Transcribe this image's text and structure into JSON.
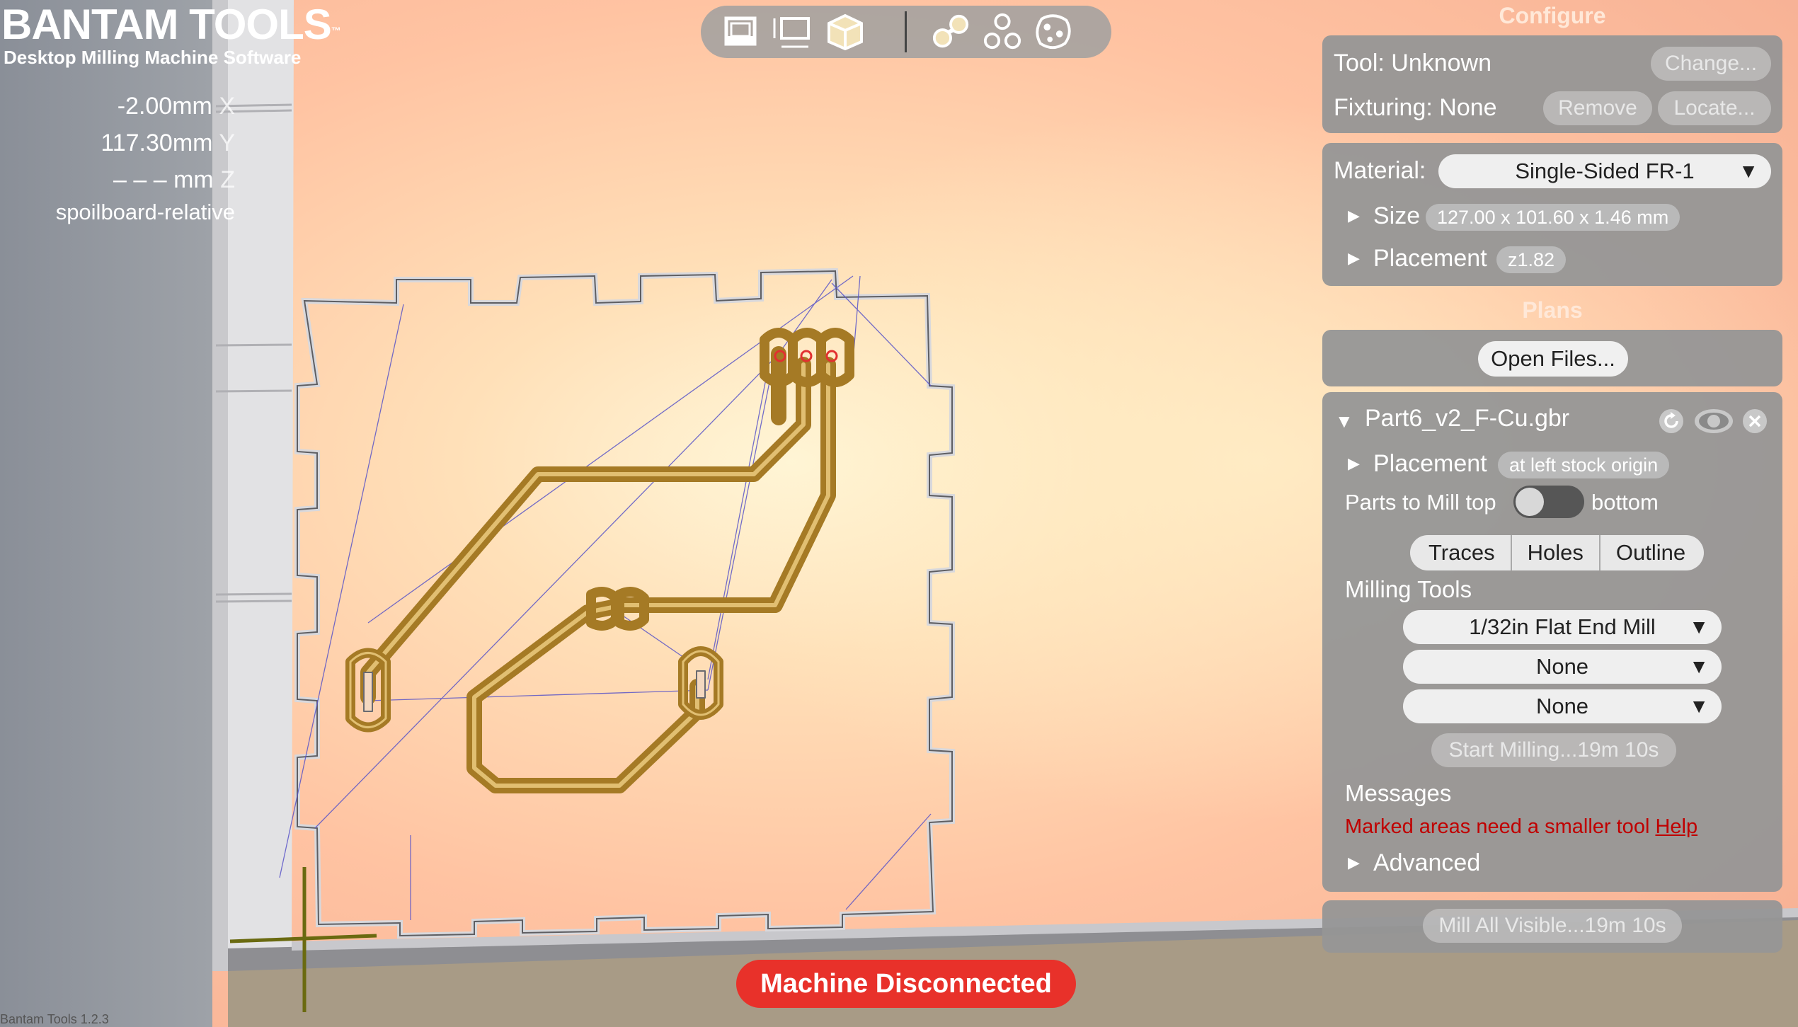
{
  "brand": {
    "logo": "BANTAM TOOLS",
    "tm": "™",
    "subtitle": "Desktop Milling Machine Software"
  },
  "readout": {
    "x_value": "-2.00mm",
    "x_axis": "X",
    "y_value": "117.30mm",
    "y_axis": "Y",
    "z_value": "– – – mm",
    "z_axis": "Z",
    "mode": "spoilboard-relative"
  },
  "view_toolbar": {
    "buttons": [
      "front-view",
      "top-view",
      "3d-view",
      "show-traces",
      "show-holes",
      "show-outline"
    ]
  },
  "configure": {
    "title": "Configure",
    "tool_label": "Tool: Unknown",
    "change_button": "Change...",
    "fixturing_label": "Fixturing: None",
    "remove_button": "Remove",
    "locate_button": "Locate...",
    "material_label": "Material:",
    "material_value": "Single-Sided FR-1",
    "size_label": "Size",
    "size_value": "127.00 x 101.60 x 1.46 mm",
    "placement_label": "Placement",
    "placement_value": "z1.82"
  },
  "plans": {
    "title": "Plans",
    "open_files_button": "Open Files...",
    "file_name": "Part6_v2_F-Cu.gbr",
    "placement_label": "Placement",
    "placement_value": "at left stock origin",
    "parts_label": "Parts to Mill",
    "parts_top": "top",
    "parts_bottom": "bottom",
    "tabs": [
      "Traces",
      "Holes",
      "Outline"
    ],
    "milling_tools_label": "Milling Tools",
    "tool_1": "1/32in Flat End Mill",
    "tool_2": "None",
    "tool_3": "None",
    "start_milling_button": "Start Milling...19m 10s",
    "messages_label": "Messages",
    "message_text": "Marked areas need a smaller tool",
    "message_link": "Help",
    "advanced_label": "Advanced"
  },
  "mill_all_button": "Mill All Visible...19m 10s",
  "status": "Machine Disconnected",
  "version": "Bantam Tools 1.2.3",
  "colors": {
    "accent": "#e8312a",
    "trace": "#b8872e",
    "panel": "#969696"
  }
}
